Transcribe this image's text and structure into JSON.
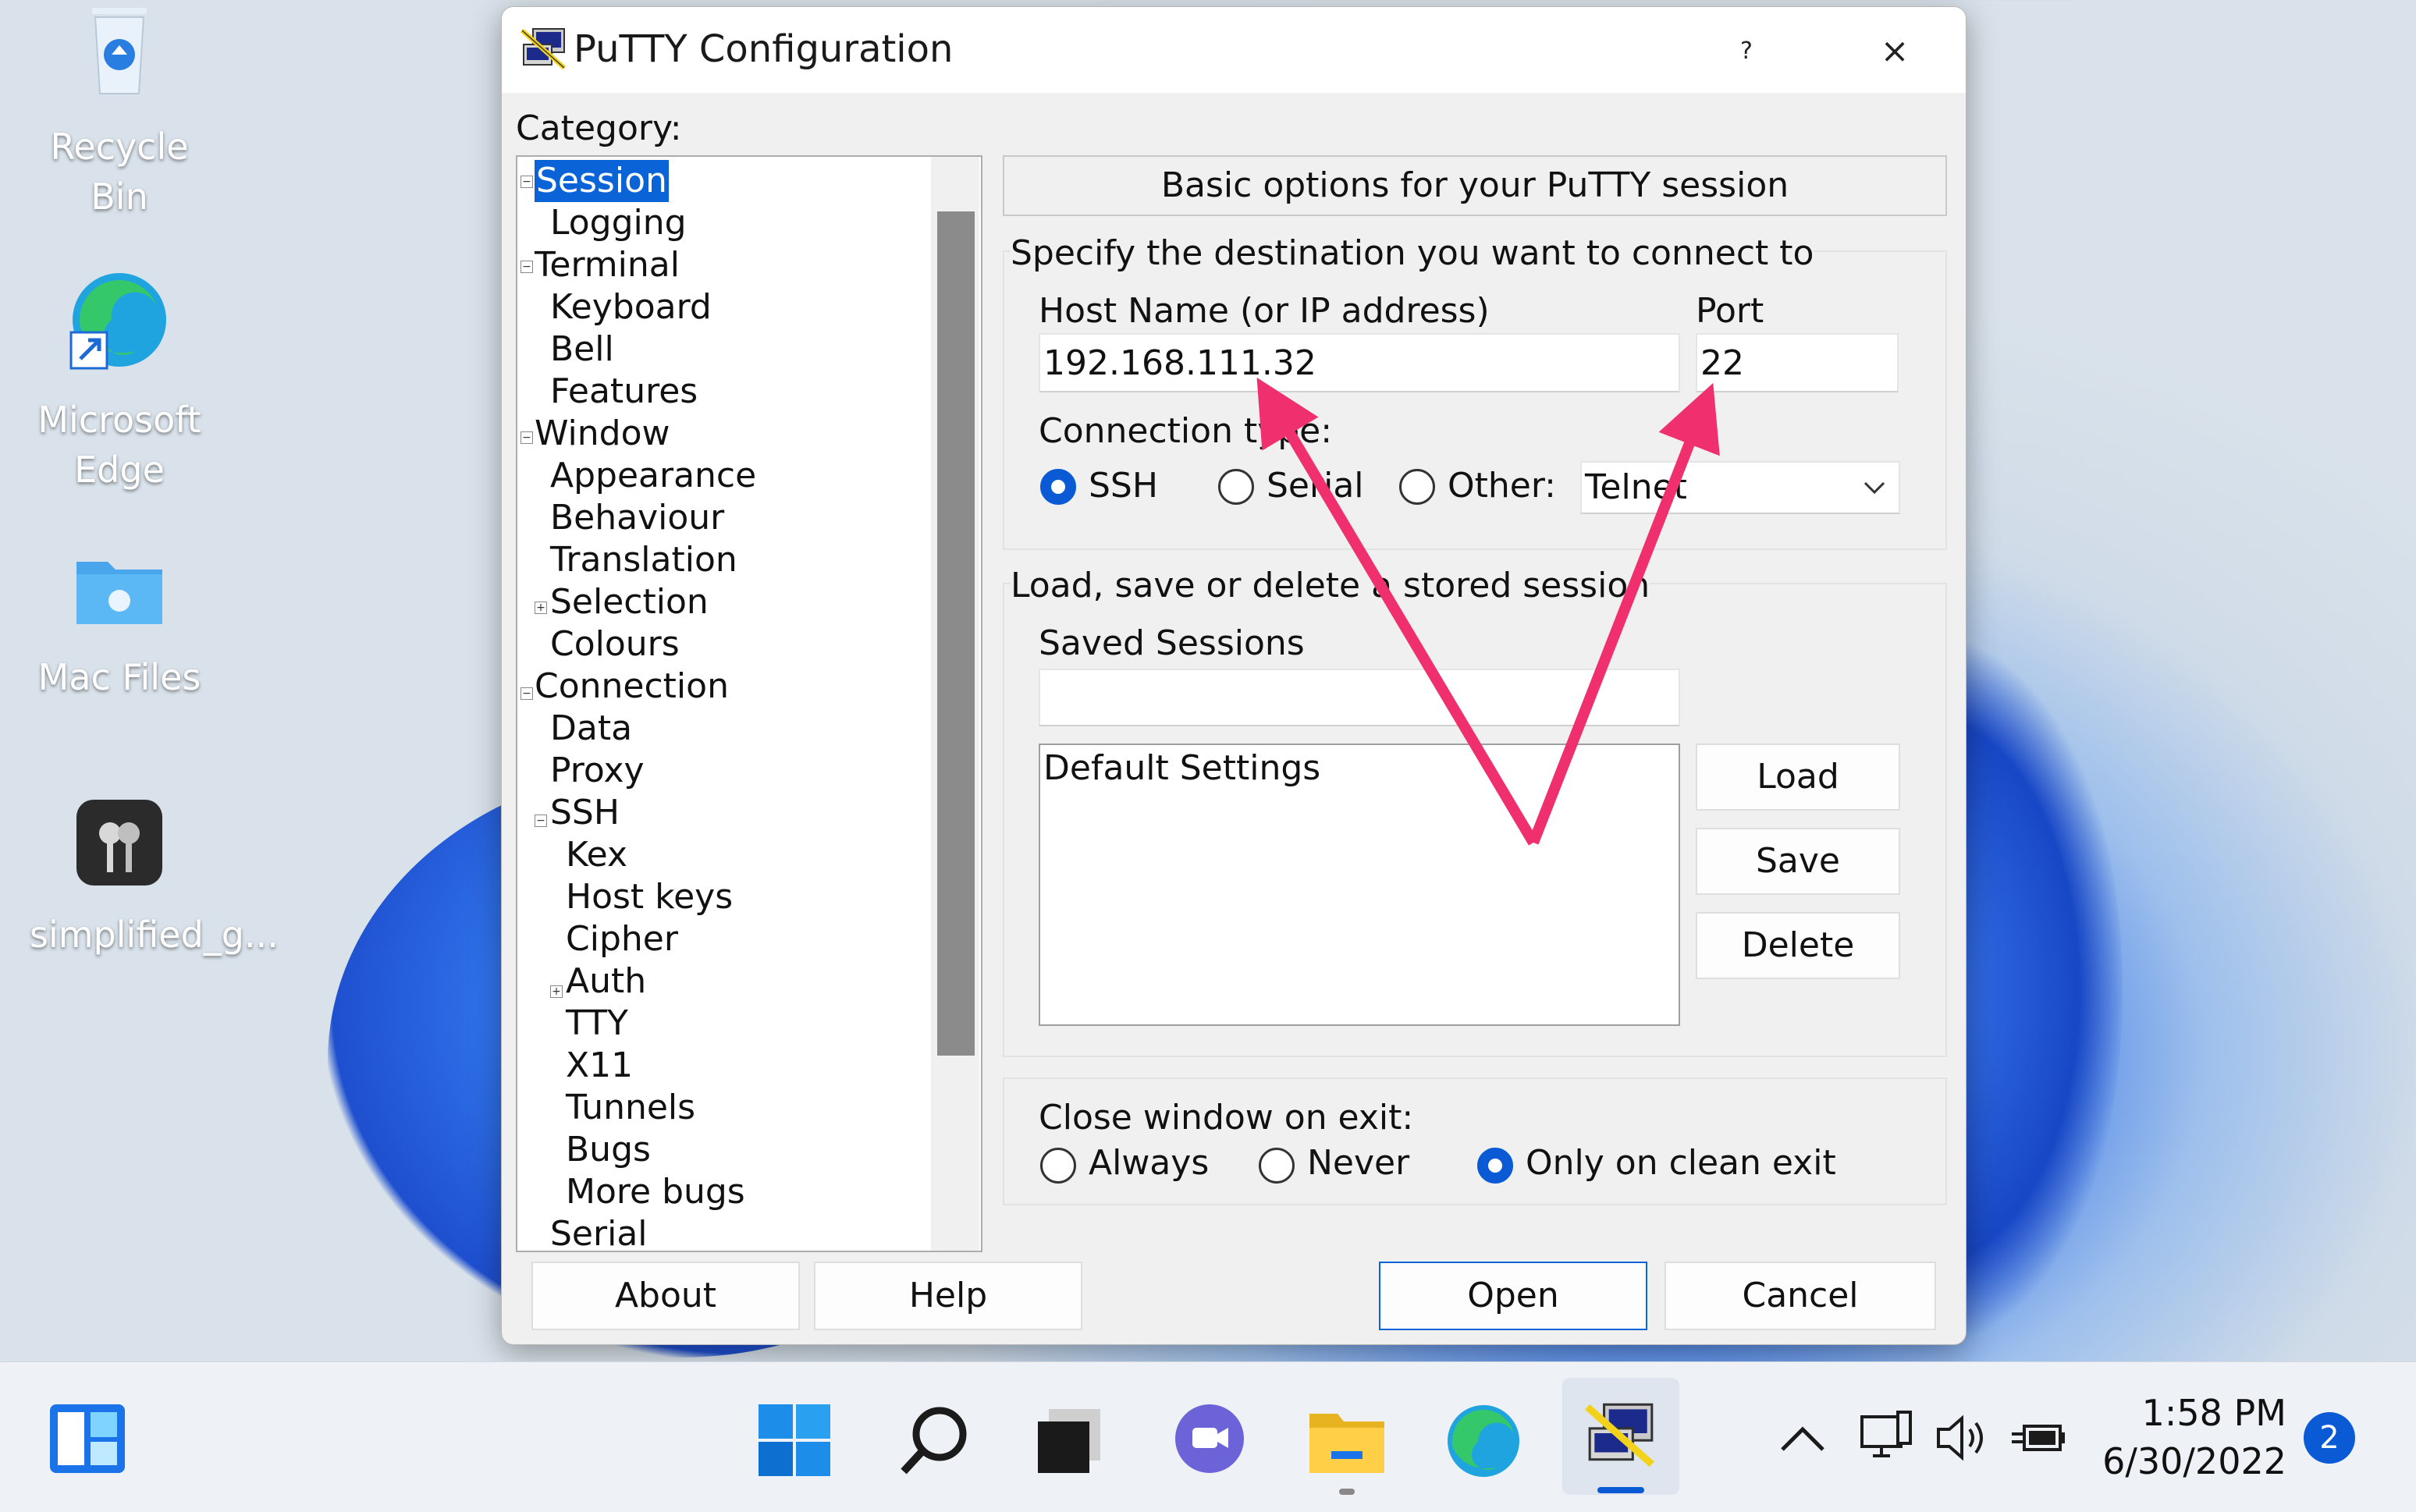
{
  "desktop": {
    "icons": [
      {
        "label": "Recycle Bin"
      },
      {
        "label": "Microsoft Edge"
      },
      {
        "label": "Mac Files"
      },
      {
        "label": "simplified_g..."
      }
    ]
  },
  "window": {
    "title": "PuTTY Configuration",
    "help_label": "?",
    "close_label": "×",
    "category_label": "Category:",
    "tree": [
      {
        "label": "Session",
        "selected": true
      },
      {
        "label": "Logging"
      },
      {
        "label": "Terminal"
      },
      {
        "label": "Keyboard"
      },
      {
        "label": "Bell"
      },
      {
        "label": "Features"
      },
      {
        "label": "Window"
      },
      {
        "label": "Appearance"
      },
      {
        "label": "Behaviour"
      },
      {
        "label": "Translation"
      },
      {
        "label": "Selection"
      },
      {
        "label": "Colours"
      },
      {
        "label": "Connection"
      },
      {
        "label": "Data"
      },
      {
        "label": "Proxy"
      },
      {
        "label": "SSH"
      },
      {
        "label": "Kex"
      },
      {
        "label": "Host keys"
      },
      {
        "label": "Cipher"
      },
      {
        "label": "Auth"
      },
      {
        "label": "TTY"
      },
      {
        "label": "X11"
      },
      {
        "label": "Tunnels"
      },
      {
        "label": "Bugs"
      },
      {
        "label": "More bugs"
      },
      {
        "label": "Serial"
      }
    ],
    "panel_header": "Basic options for your PuTTY session",
    "destination_label": "Specify the destination you want to connect to",
    "host_label": "Host Name (or IP address)",
    "host_value": "192.168.111.32",
    "port_label": "Port",
    "port_value": "22",
    "conn_type_label": "Connection type:",
    "conn_types": [
      "SSH",
      "Serial",
      "Other:"
    ],
    "conn_selected": "SSH",
    "other_select_value": "Telnet",
    "sessions_group_label": "Load, save or delete a stored session",
    "saved_sessions_label": "Saved Sessions",
    "saved_sessions_input": "",
    "sessions_list": [
      "Default Settings"
    ],
    "load_label": "Load",
    "save_label": "Save",
    "delete_label": "Delete",
    "close_exit_label": "Close window on exit:",
    "exit_options": [
      "Always",
      "Never",
      "Only on clean exit"
    ],
    "exit_selected": "Only on clean exit",
    "about_label": "About",
    "help_button_label": "Help",
    "open_label": "Open",
    "cancel_label": "Cancel"
  },
  "taskbar": {
    "time": "1:58 PM",
    "date": "6/30/2022",
    "notifications": "2"
  },
  "colors": {
    "accent": "#0a64d8",
    "annotation_arrow": "#f0306e"
  }
}
